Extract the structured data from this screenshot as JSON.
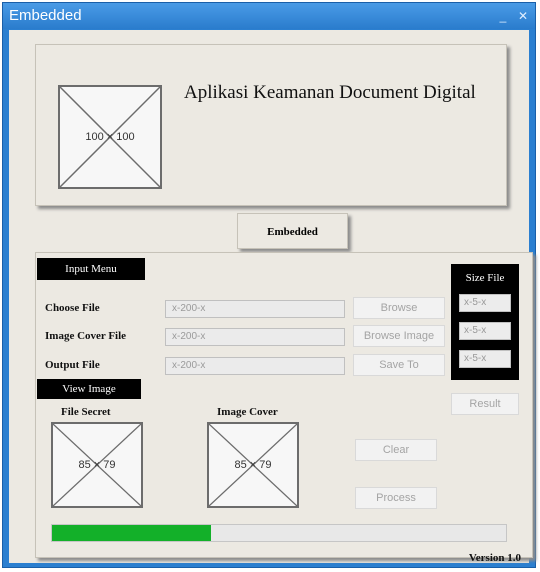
{
  "window": {
    "title": "Embedded"
  },
  "header": {
    "logo_placeholder": "100 × 100",
    "app_title": "Aplikasi Keamanan Document Digital"
  },
  "tabs": {
    "embedded": "Embedded"
  },
  "input_menu": {
    "label": "Input Menu",
    "rows": [
      {
        "label": "Choose File",
        "value": "x-200-x",
        "button": "Browse"
      },
      {
        "label": "Image Cover File",
        "value": "x-200-x",
        "button": "Browse Image"
      },
      {
        "label": "Output File",
        "value": "x-200-x",
        "button": "Save To"
      }
    ]
  },
  "size_file": {
    "title": "Size File",
    "values": [
      "x-5-x",
      "x-5-x",
      "x-5-x"
    ]
  },
  "view_image": {
    "label": "View Image",
    "file_secret": {
      "caption": "File Secret",
      "placeholder": "85 × 79"
    },
    "image_cover": {
      "caption": "Image Cover",
      "placeholder": "85 × 79"
    }
  },
  "actions": {
    "result": "Result",
    "clear": "Clear",
    "process": "Process"
  },
  "progress": {
    "value": 0.35,
    "color": "#13b029"
  },
  "footer": {
    "version": "Version 1.0"
  }
}
